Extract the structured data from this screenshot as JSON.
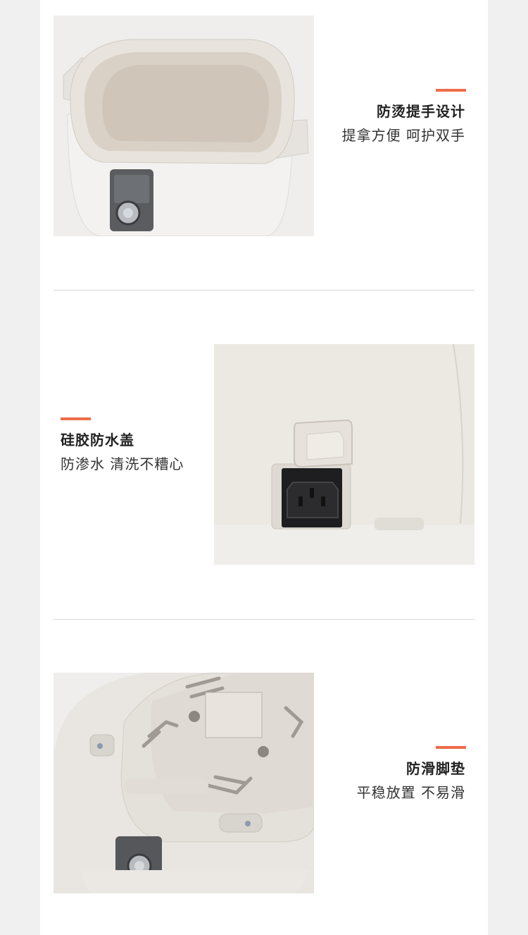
{
  "features": [
    {
      "title": "防烫提手设计",
      "subtitle": "提拿方便 呵护双手"
    },
    {
      "title": "硅胶防水盖",
      "subtitle": "防渗水 清洗不糟心"
    },
    {
      "title": "防滑脚垫",
      "subtitle": "平稳放置 不易滑"
    }
  ],
  "colors": {
    "accent": "#ef6c4a",
    "product": "#ebe8e2",
    "background": "#ffffff",
    "side": "#f0f0f0"
  },
  "icons": [
    "dial-knob-icon",
    "power-socket-icon",
    "vent-slot-icon",
    "rubber-foot-icon"
  ]
}
